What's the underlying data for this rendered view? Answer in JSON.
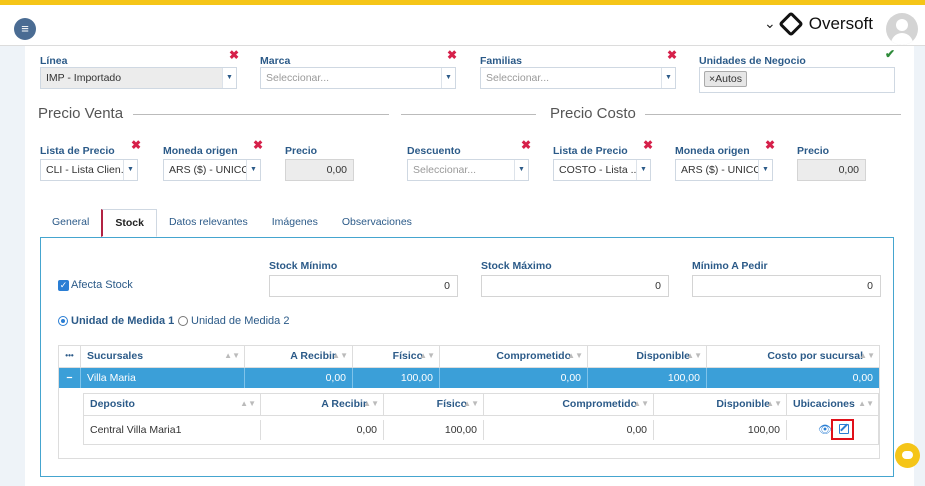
{
  "header": {
    "brand_chevron": "⌄",
    "brand_name": "Oversoft"
  },
  "filters": {
    "linea": {
      "label": "Línea",
      "value": "IMP - Importado"
    },
    "marca": {
      "label": "Marca",
      "placeholder": "Seleccionar..."
    },
    "familias": {
      "label": "Familias",
      "placeholder": "Seleccionar..."
    },
    "unidades": {
      "label": "Unidades de Negocio",
      "tag": "Autos",
      "tag_remove": "×"
    }
  },
  "precio_venta": {
    "title": "Precio Venta",
    "lista_label": "Lista de Precio",
    "lista_value": "CLI - Lista Clien...",
    "moneda_label": "Moneda origen",
    "moneda_value": "ARS ($) - UNICO",
    "precio_label": "Precio",
    "precio_value": "0,00",
    "descuento_label": "Descuento",
    "descuento_placeholder": "Seleccionar..."
  },
  "precio_costo": {
    "title": "Precio Costo",
    "lista_label": "Lista de Precio",
    "lista_value": "COSTO - Lista ...",
    "moneda_label": "Moneda origen",
    "moneda_value": "ARS ($) - UNICO",
    "precio_label": "Precio",
    "precio_value": "0,00"
  },
  "tabs": [
    "General",
    "Stock",
    "Datos relevantes",
    "Imágenes",
    "Observaciones"
  ],
  "stock": {
    "afecta_label": "Afecta Stock",
    "minimo_label": "Stock Mínimo",
    "minimo_value": "0",
    "maximo_label": "Stock Máximo",
    "maximo_value": "0",
    "pedir_label": "Mínimo A Pedir",
    "pedir_value": "0",
    "unidad1": "Unidad de Medida 1",
    "unidad2": "Unidad de Medida 2"
  },
  "sucursales_table": {
    "columns": [
      "Sucursales",
      "A Recibir",
      "Físico",
      "Comprometido",
      "Disponible",
      "Costo por sucursal"
    ],
    "menu_glyph": "•••",
    "collapse_glyph": "−",
    "row": [
      "Villa Maria",
      "0,00",
      "100,00",
      "0,00",
      "100,00",
      "0,00"
    ]
  },
  "deposito_table": {
    "columns": [
      "Deposito",
      "A Recibir",
      "Físico",
      "Comprometido",
      "Disponible",
      "Ubicaciones"
    ],
    "row": [
      "Central Villa Maria1",
      "0,00",
      "100,00",
      "0,00",
      "100,00"
    ]
  },
  "icons": {
    "sort": "▲▼",
    "menu": "≡",
    "check": "✓",
    "remove": "✖",
    "valid": "✔",
    "dropdown": "▼",
    "eye": "👁"
  },
  "colors": {
    "accent": "#2b5a88",
    "selected_row": "#3b9fd8",
    "highlight_border": "#e0101a",
    "top_stripe": "#f5c518"
  }
}
